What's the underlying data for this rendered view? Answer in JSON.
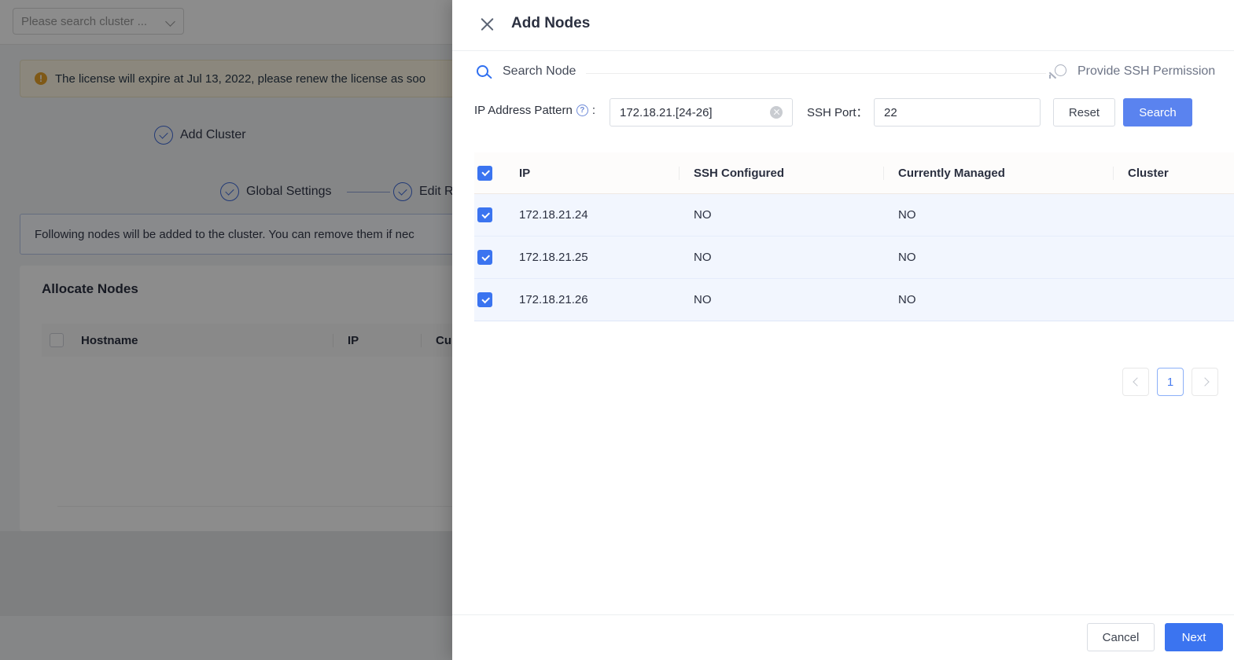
{
  "background": {
    "cluster_select_placeholder": "Please search cluster ...",
    "license_notice": "The license will expire at Jul 13, 2022, please renew the license as soo",
    "steps": [
      {
        "label": "Add Cluster"
      },
      {
        "label": "Global Settings"
      },
      {
        "label": "Edit R"
      }
    ],
    "info_bar": "Following nodes will be added to the cluster. You can remove them if nec",
    "card_title": "Allocate Nodes",
    "card_table_headers": [
      "Hostname",
      "IP",
      "Currently"
    ]
  },
  "drawer": {
    "title": "Add Nodes",
    "close_icon": "close-icon",
    "section": {
      "search_icon": "search-icon",
      "label": "Search Node",
      "ssh_permission_icon": "key-icon",
      "ssh_permission_label": "Provide SSH Permission"
    },
    "filters": {
      "ip_pattern_label": "IP Address Pattern",
      "ip_pattern_help_icon": "help-icon",
      "ip_pattern_colon": ":",
      "ip_pattern_value": "172.18.21.[24-26]",
      "ip_pattern_placeholder": "IP Address Pattern",
      "clear_icon": "clear-icon",
      "ssh_port_label": "SSH Port：",
      "ssh_port_value": "22",
      "ssh_port_placeholder": "SSH Port",
      "reset_label": "Reset",
      "search_label": "Search"
    },
    "table": {
      "select_all_checked": true,
      "headers": [
        "IP",
        "SSH Configured",
        "Currently Managed",
        "Cluster"
      ],
      "rows": [
        {
          "checked": true,
          "ip": "172.18.21.24",
          "ssh_configured": "NO",
          "currently_managed": "NO",
          "cluster": ""
        },
        {
          "checked": true,
          "ip": "172.18.21.25",
          "ssh_configured": "NO",
          "currently_managed": "NO",
          "cluster": ""
        },
        {
          "checked": true,
          "ip": "172.18.21.26",
          "ssh_configured": "NO",
          "currently_managed": "NO",
          "cluster": ""
        }
      ]
    },
    "pagination": {
      "prev_icon": "chevron-left-icon",
      "current_page": "1",
      "next_icon": "chevron-right-icon"
    },
    "footer": {
      "cancel_label": "Cancel",
      "next_label": "Next"
    }
  },
  "colors": {
    "primary_blue": "#3b74f0",
    "search_button_blue": "#5a83ef",
    "row_selected": "#f2f6fe",
    "warning_bg": "#fdf6e3",
    "warning_dot": "#e8a32b"
  }
}
